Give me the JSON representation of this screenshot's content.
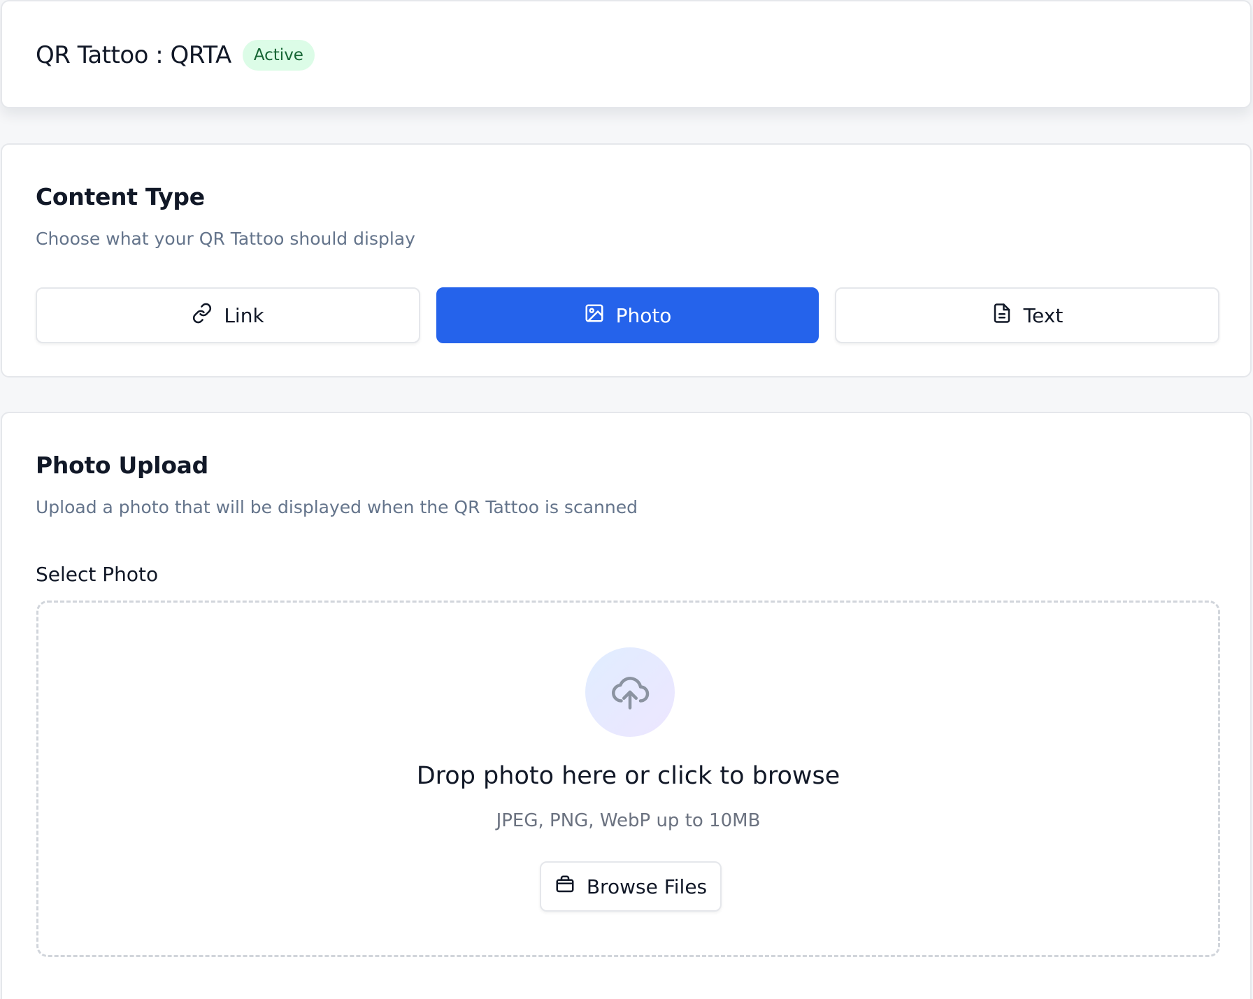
{
  "header": {
    "title": "QR Tattoo : QRTA",
    "status_badge": "Active"
  },
  "content_type": {
    "title": "Content Type",
    "subtitle": "Choose what your QR Tattoo should display",
    "options": [
      {
        "label": "Link",
        "icon": "link-icon",
        "selected": false
      },
      {
        "label": "Photo",
        "icon": "image-icon",
        "selected": true
      },
      {
        "label": "Text",
        "icon": "file-text-icon",
        "selected": false
      }
    ]
  },
  "photo_upload": {
    "title": "Photo Upload",
    "subtitle": "Upload a photo that will be displayed when the QR Tattoo is scanned",
    "field_label": "Select Photo",
    "dropzone": {
      "icon": "cloud-upload-icon",
      "title": "Drop photo here or click to browse",
      "hint": "JPEG, PNG, WebP up to 10MB",
      "browse_label": "Browse Files",
      "browse_icon": "briefcase-icon"
    }
  },
  "colors": {
    "accent": "#2563eb",
    "badge_bg": "#dcfce7",
    "badge_text": "#166534",
    "muted_text": "#64748b"
  }
}
